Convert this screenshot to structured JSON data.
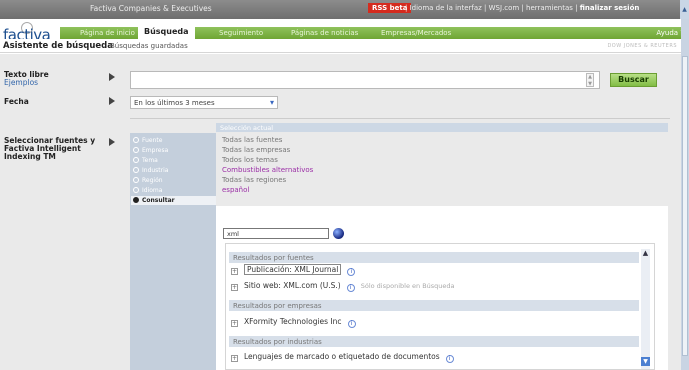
{
  "topbar": {
    "company": "Factiva Companies & Executives",
    "rss": "RSS beta",
    "links": "| Idioma de la interfaz | WSJ.com | herramientas | ",
    "logout": "finalizar sesión"
  },
  "brand": {
    "logo": "factiva"
  },
  "nav": {
    "tabs": [
      "Página de inicio",
      "Búsqueda",
      "Seguimiento",
      "Páginas de noticias",
      "Empresas/Mercados"
    ],
    "active_tab": "Búsqueda",
    "help": "Ayuda ?"
  },
  "subbar": {
    "title": "Asistente de búsqueda",
    "saved": "Búsquedas guardadas",
    "dj": "DOW JONES & REUTERS"
  },
  "form": {
    "free_text_label": "Texto libre",
    "examples_link": "Ejemplos",
    "search_button": "Buscar",
    "date_label": "Fecha",
    "date_value": "En los últimos 3 meses",
    "sources_label": "Seleccionar fuentes y Factiva Intelligent Indexing TM"
  },
  "selection": {
    "title": "Selección actual",
    "categories": [
      "Fuente",
      "Empresa",
      "Tema",
      "Industria",
      "Región",
      "Idioma",
      "Consultar"
    ],
    "active_category": "Consultar",
    "values": [
      "Todas las fuentes",
      "Todas las empresas",
      "Todos los temas",
      "Combustibles alternativos",
      "Todas las regiones",
      "español"
    ]
  },
  "lookup": {
    "query": "xml"
  },
  "results": {
    "groups": [
      {
        "title": "Resultados por fuentes",
        "items": [
          {
            "label": "Publicación: XML Journal",
            "note": ""
          },
          {
            "label": "Sitio web: XML.com (U.S.)",
            "note": "Sólo disponible en Búsqueda"
          }
        ]
      },
      {
        "title": "Resultados por empresas",
        "items": [
          {
            "label": "XFormity Technologies Inc",
            "note": ""
          }
        ]
      },
      {
        "title": "Resultados por industrias",
        "items": [
          {
            "label": "Lenguajes de marcado o etiquetado de documentos",
            "note": ""
          }
        ]
      }
    ]
  },
  "icons": {
    "info": "info-icon",
    "expand": "plus-icon",
    "globe": "globe-icon",
    "arrow": "arrow-right-icon"
  },
  "colors": {
    "green_nav": "#7fb544",
    "topbar": "#7a7a7a",
    "highlight_purple": "#9b2fa6",
    "rss_red": "#d52b1e"
  }
}
